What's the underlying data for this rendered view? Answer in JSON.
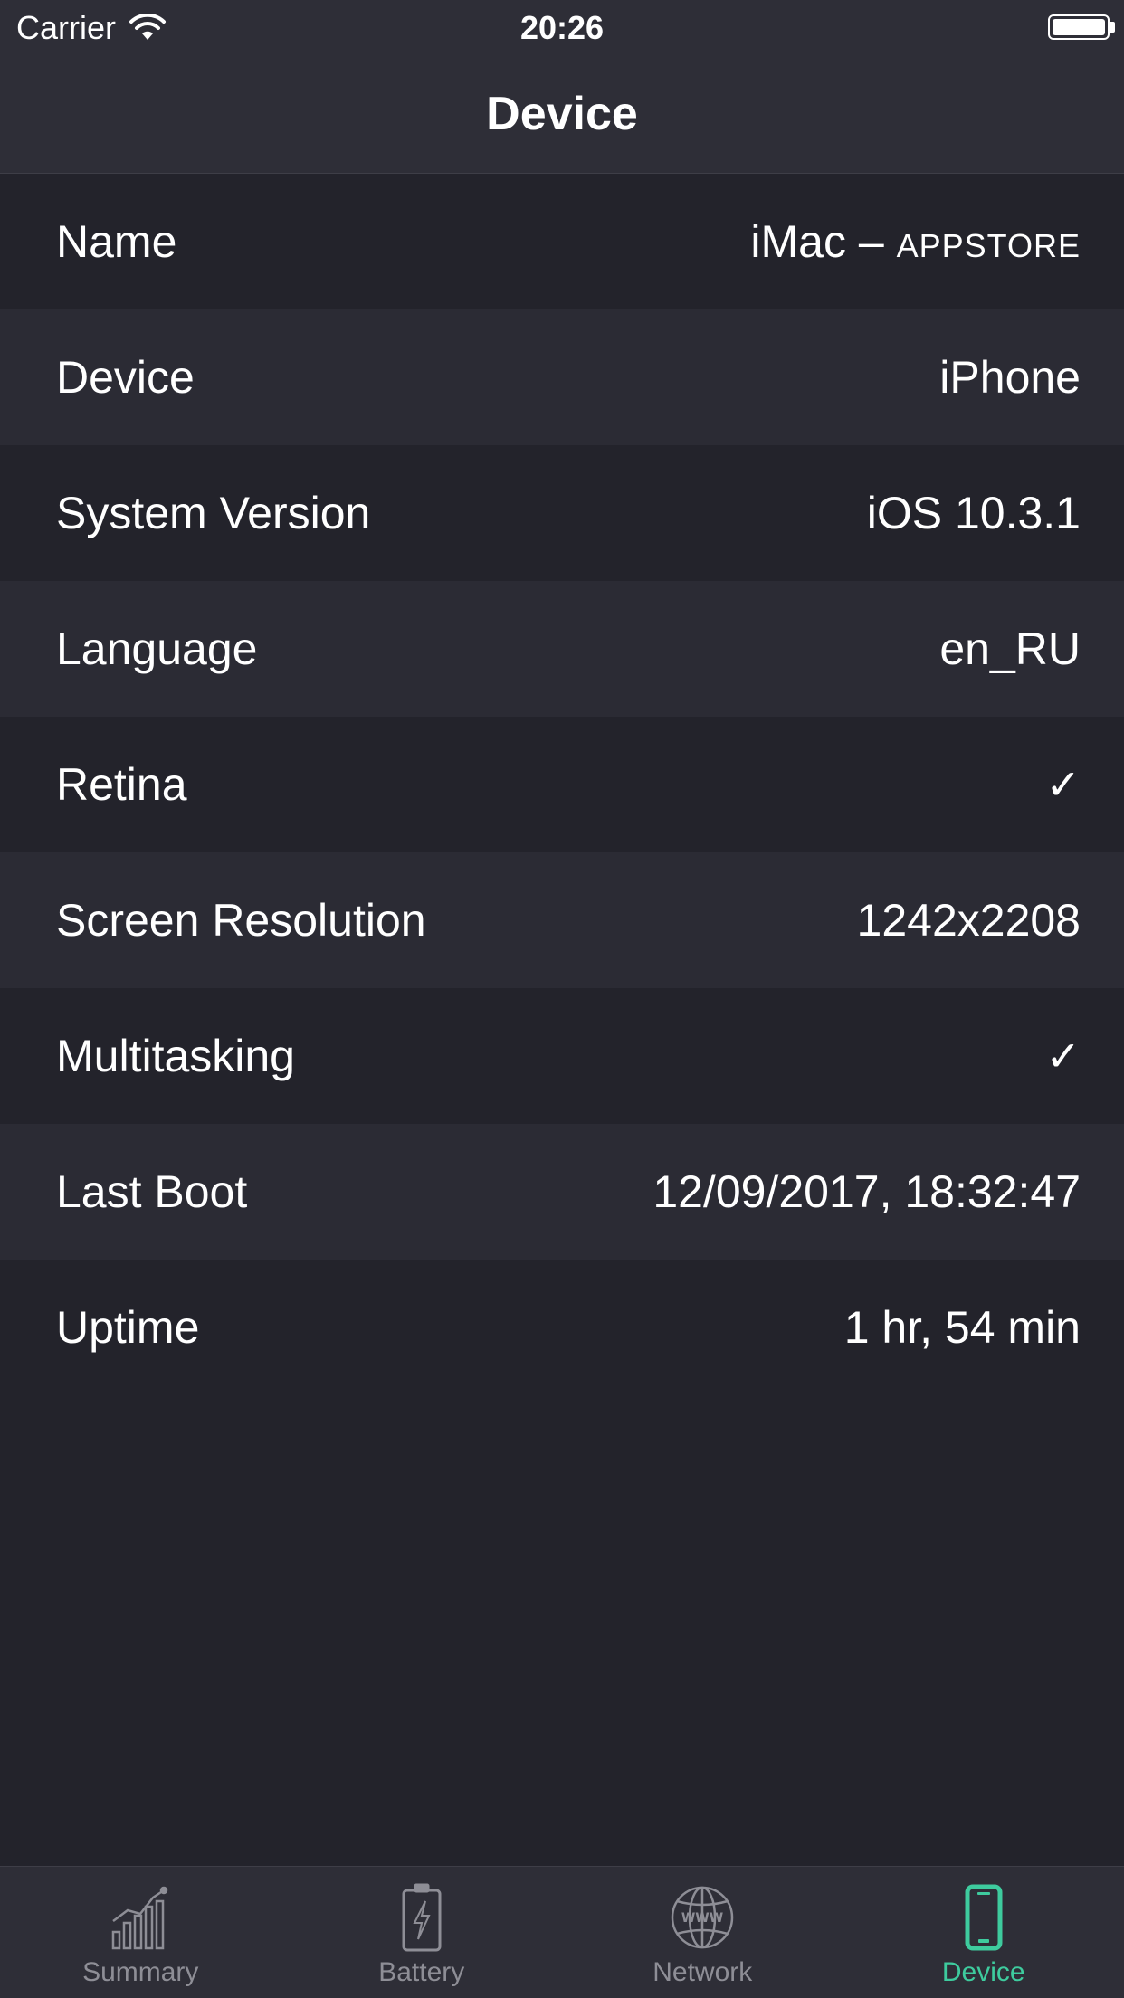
{
  "status_bar": {
    "carrier": "Carrier",
    "time": "20:26"
  },
  "nav": {
    "title": "Device"
  },
  "rows": [
    {
      "label": "Name",
      "value_prefix": "iMac – ",
      "value_suffix": "APPSTORE"
    },
    {
      "label": "Device",
      "value": "iPhone"
    },
    {
      "label": "System Version",
      "value": "iOS 10.3.1"
    },
    {
      "label": "Language",
      "value": "en_RU"
    },
    {
      "label": "Retina",
      "value": "✓"
    },
    {
      "label": "Screen Resolution",
      "value": "1242x2208"
    },
    {
      "label": "Multitasking",
      "value": "✓"
    },
    {
      "label": "Last Boot",
      "value": "12/09/2017, 18:32:47"
    },
    {
      "label": "Uptime",
      "value": "1 hr, 54 min"
    }
  ],
  "tabs": [
    {
      "label": "Summary",
      "icon": "chart-icon",
      "active": false
    },
    {
      "label": "Battery",
      "icon": "battery-icon",
      "active": false
    },
    {
      "label": "Network",
      "icon": "globe-icon",
      "active": false
    },
    {
      "label": "Device",
      "icon": "phone-icon",
      "active": true
    }
  ],
  "colors": {
    "background": "#23232b",
    "row_alt": "#2b2b34",
    "bar": "#2e2e37",
    "accent": "#3ecb9e",
    "inactive": "#8e8e96"
  }
}
